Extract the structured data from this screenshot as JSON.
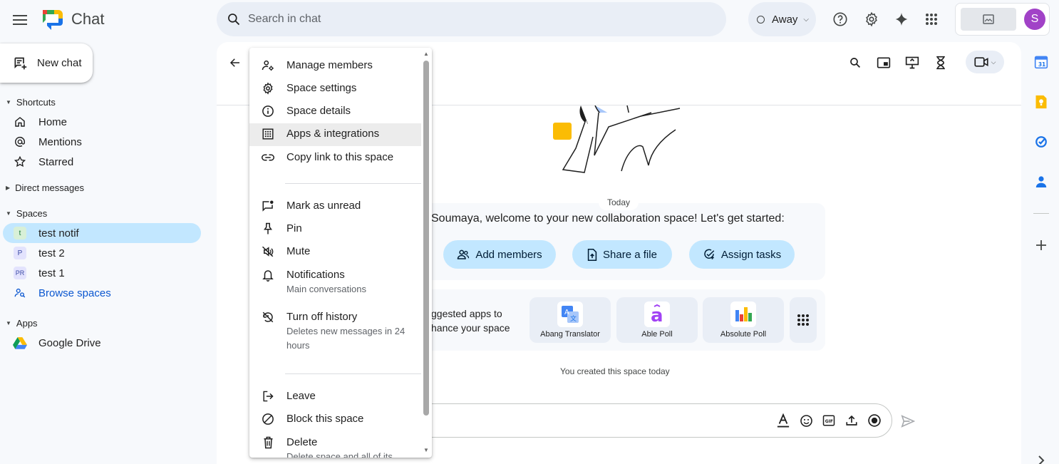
{
  "app": {
    "title": "Chat"
  },
  "search": {
    "placeholder": "Search in chat"
  },
  "status": {
    "label": "Away"
  },
  "user": {
    "initial": "S"
  },
  "nav": {
    "new_chat": "New chat",
    "shortcuts": {
      "heading": "Shortcuts",
      "items": [
        "Home",
        "Mentions",
        "Starred"
      ]
    },
    "direct_messages": {
      "heading": "Direct messages"
    },
    "spaces": {
      "heading": "Spaces",
      "items": [
        {
          "initial": "t",
          "label": "test notif",
          "active": true
        },
        {
          "initial": "P",
          "label": "test 2"
        },
        {
          "initial": "PR",
          "label": "test 1"
        }
      ],
      "browse": "Browse spaces"
    },
    "apps": {
      "heading": "Apps",
      "items": [
        "Google Drive"
      ]
    }
  },
  "menu": {
    "items": [
      {
        "label": "Manage members",
        "icon": "manage-members-icon"
      },
      {
        "label": "Space settings",
        "icon": "gear-icon"
      },
      {
        "label": "Space details",
        "icon": "info-icon"
      },
      {
        "label": "Apps & integrations",
        "icon": "apps-icon"
      },
      {
        "label": "Copy link to this space",
        "icon": "link-icon"
      },
      {
        "label": "Mark as unread",
        "icon": "mark-unread-icon"
      },
      {
        "label": "Pin",
        "icon": "pin-icon"
      },
      {
        "label": "Mute",
        "icon": "mute-icon"
      },
      {
        "label": "Notifications",
        "sub": "Main conversations",
        "icon": "bell-icon"
      },
      {
        "label": "Turn off history",
        "sub": "Deletes new messages in 24 hours",
        "icon": "history-off-icon"
      },
      {
        "label": "Leave",
        "icon": "leave-icon"
      },
      {
        "label": "Block this space",
        "icon": "block-icon"
      },
      {
        "label": "Delete",
        "sub": "Delete space and all of its",
        "icon": "trash-icon"
      }
    ]
  },
  "main": {
    "today": "Today",
    "welcome": "Soumaya, welcome to your new collaboration space! Let's get started:",
    "actions": [
      "Add members",
      "Share a file",
      "Assign tasks"
    ],
    "apps_prompt": "ggested apps to\nhance your space",
    "apps": [
      "Abang Translator",
      "Able Poll",
      "Absolute Poll"
    ],
    "created": "You created this space today"
  },
  "colors": {
    "accent": "#c2e7ff",
    "avatar": "#a142c7",
    "link": "#0b57d0"
  }
}
